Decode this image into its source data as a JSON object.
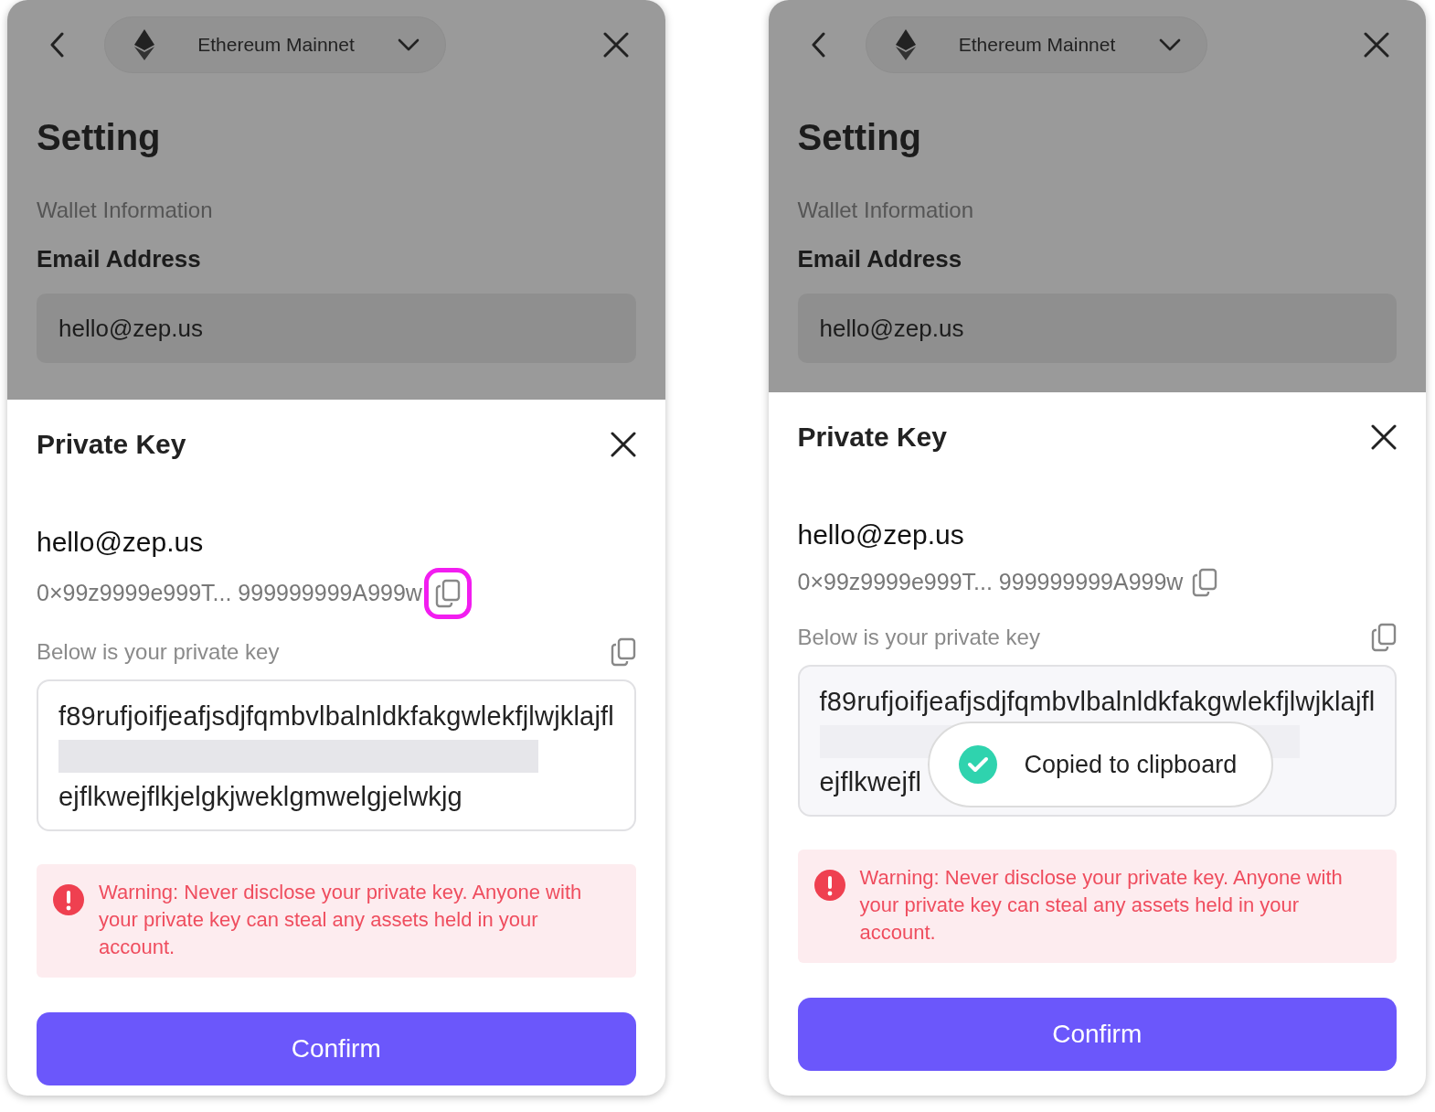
{
  "panels": [
    {
      "network": {
        "name": "Ethereum Mainnet"
      },
      "title": "Setting",
      "section": "Wallet Information",
      "email_label": "Email Address",
      "email_value": "hello@zep.us",
      "sheet": {
        "title": "Private Key",
        "email": "hello@zep.us",
        "address": "0×99z9999e999T... 999999999A999w",
        "address_copy_highlighted": true,
        "key_label": "Below is your private key",
        "key_lines": [
          {
            "kind": "text",
            "text": "f89rufjoifjeafjsdjfqmbvlbalnldkfakgwlekfjlwjklajfl"
          },
          {
            "kind": "redacted"
          },
          {
            "kind": "text",
            "text": "ejflkwejflkjelgkjweklgmwelgjelwkjg"
          }
        ],
        "warning": "Warning: Never disclose your private key. Anyone with your private key can steal any assets held in your account.",
        "confirm": "Confirm"
      }
    },
    {
      "network": {
        "name": "Ethereum Mainnet"
      },
      "title": "Setting",
      "section": "Wallet Information",
      "email_label": "Email Address",
      "email_value": "hello@zep.us",
      "sheet": {
        "title": "Private Key",
        "email": "hello@zep.us",
        "address": "0×99z9999e999T... 999999999A999w",
        "address_copy_highlighted": false,
        "key_label": "Below is your private key",
        "key_lines": [
          {
            "kind": "text",
            "text": "f89rufjoifjeafjsdjfqmbvlbalnldkfakgwlekfjlwjklajfl"
          },
          {
            "kind": "redacted"
          },
          {
            "kind": "text",
            "text": "ejflkwejfl"
          }
        ],
        "warning": "Warning: Never disclose your private key. Anyone with your private key can steal any assets held in your account.",
        "confirm": "Confirm",
        "toast": {
          "text": "Copied to clipboard"
        }
      }
    }
  ]
}
